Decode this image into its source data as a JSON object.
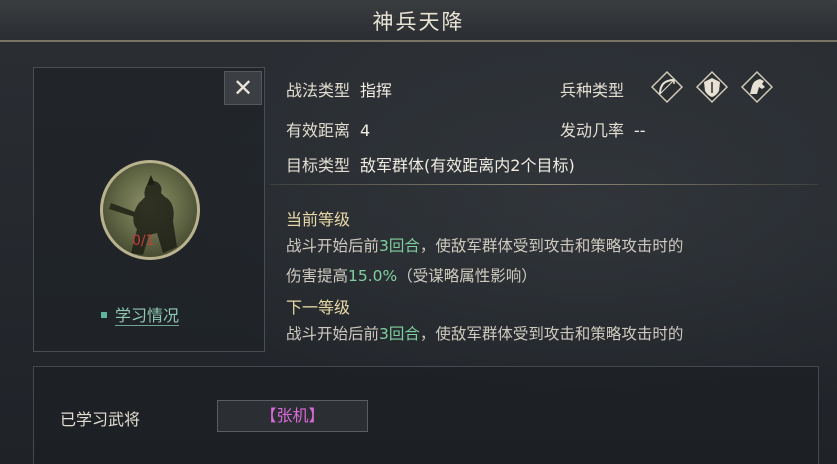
{
  "title": "神兵天降",
  "close_label": "✕",
  "portrait": {
    "count_text": "0/1",
    "learn_status_label": "学习情况"
  },
  "info": {
    "tactic_type_label": "战法类型",
    "tactic_type_value": "指挥",
    "troop_type_label": "兵种类型",
    "range_label": "有效距离",
    "range_value": "4",
    "trigger_rate_label": "发动几率",
    "trigger_rate_value": "--",
    "target_type_label": "目标类型",
    "target_type_value": "敌军群体(有效距离内2个目标)"
  },
  "troop_icons": [
    "bow-troop-icon",
    "shield-troop-icon",
    "cavalry-troop-icon"
  ],
  "description": {
    "current_level_heading": "当前等级",
    "current_line1_a": "战斗开始后前",
    "current_line1_highlight": "3回合",
    "current_line1_b": "，使敌军群体受到攻击和策略攻击时的",
    "current_line2_a": "伤害提高",
    "current_line2_highlight": "15.0%",
    "current_line2_b": "（受谋略属性影响）",
    "next_level_heading": "下一等级",
    "next_line1_a": "战斗开始后前",
    "next_line1_highlight": "3回合",
    "next_line1_b": "，使敌军群体受到攻击和策略攻击时的"
  },
  "learned": {
    "label": "已学习武将",
    "general": "【张机】"
  },
  "colors": {
    "highlight_green": "#7fd0a0",
    "general_purple": "#d96ad9",
    "count_red": "#c23d3d"
  }
}
